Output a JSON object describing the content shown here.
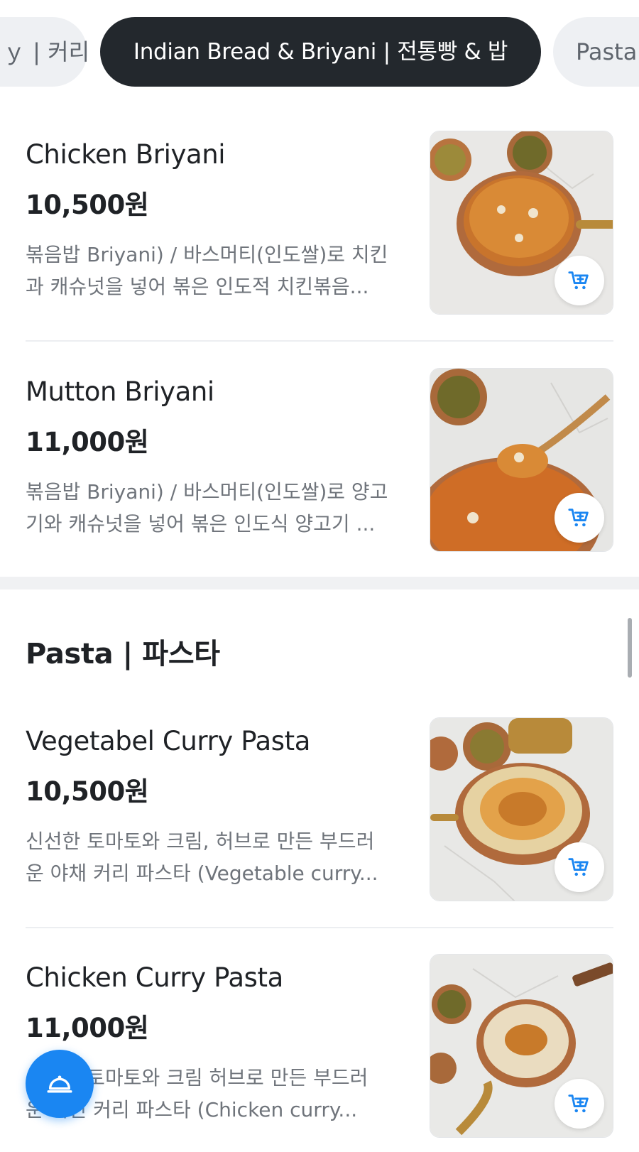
{
  "category_chips": {
    "left_partial": "ｙ | 커리",
    "active": "Indian Bread & Briyani | 전통빵 & 밥",
    "right_partial": "Pasta"
  },
  "sections": {
    "pasta_title": "Pasta | 파스타"
  },
  "items": [
    {
      "name": "Chicken Briyani",
      "price": "10,500원",
      "desc_line1": "볶음밥 Briyani) / 바스머티(인도쌀)로 치킨",
      "desc_line2": "과 캐슈넛을 넣어 볶은 인도적 치킨볶음..."
    },
    {
      "name": "Mutton Briyani",
      "price": "11,000원",
      "desc_line1": "볶음밥 Briyani) / 바스머티(인도쌀)로 양고",
      "desc_line2": "기와 캐슈넛을 넣어 볶은 인도식 양고기 ..."
    },
    {
      "name": "Vegetabel Curry Pasta",
      "price": "10,500원",
      "desc_line1": "신선한 토마토와 크림, 허브로 만든 부드러",
      "desc_line2": "운 야채 커리 파스타 (Vegetable curry..."
    },
    {
      "name": "Chicken Curry Pasta",
      "price": "11,000원",
      "desc_line1": "신선한 토마토와 크림 허브로 만든 부드러",
      "desc_line2": "운 치킨 커리 파스타 (Chicken curry..."
    }
  ],
  "icons": {
    "cart": "cart-plus-icon",
    "fab": "cloche-icon"
  },
  "colors": {
    "accent": "#1a86f2",
    "active_chip": "#23282d"
  }
}
